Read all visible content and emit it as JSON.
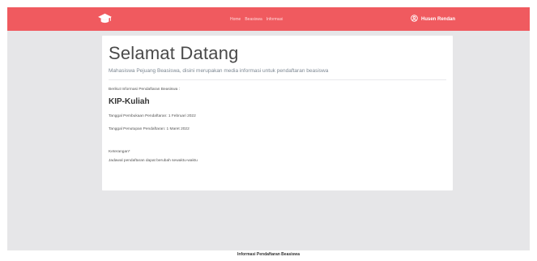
{
  "nav": {
    "links": [
      "Home",
      "Beasiswa",
      "Informasi"
    ],
    "user_name": "Husen Rendan",
    "brand_icon": "graduation-cap-icon",
    "user_icon": "user-circle-icon"
  },
  "hero": {
    "title": "Selamat Datang",
    "subtitle": "Mahasiswa Pejuang Beasiswa, disini merupakan media informasi untuk pendaftaran beasiswa"
  },
  "info": {
    "intro": "Berikut Informasi Pendaftaran Beasiswa :",
    "program": "KIP-Kuliah",
    "open_date": "Tanggal Pembukaan Pendaftaran: 1 Februari 2022",
    "close_date": "Tanggal Penutupan Pendaftaran: 1 Maret 2022",
    "note_label": "Keterangan*",
    "note": "Jadawal pendaftaran dapat berubah sewaktu-waktu"
  },
  "footer": {
    "text": "Informasi Pendaftaran Beasiswa"
  },
  "colors": {
    "navbar": "#f05a5f",
    "page_bg": "#e6e6e8",
    "card_bg": "#ffffff"
  }
}
